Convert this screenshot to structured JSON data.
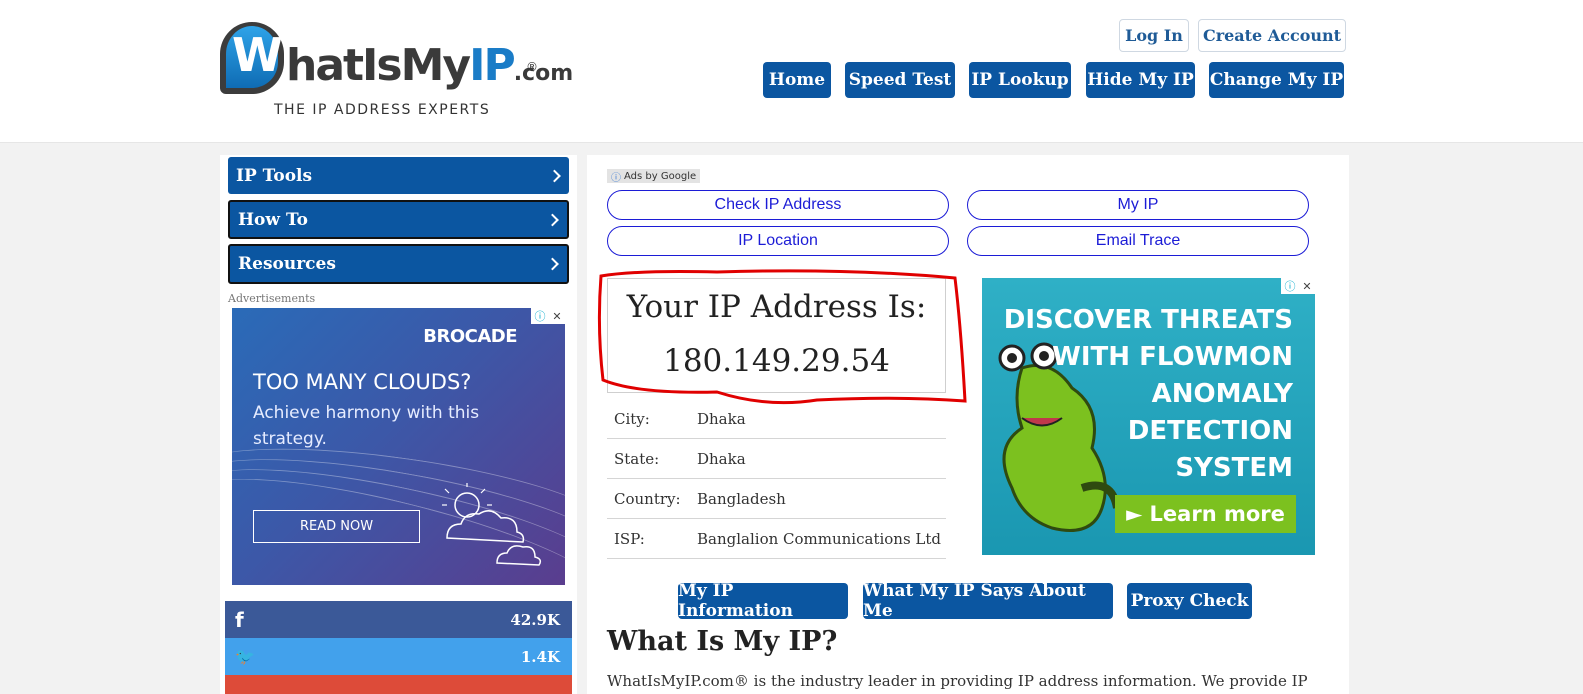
{
  "header": {
    "logo": {
      "w": "W",
      "text_a": "hatIsMy",
      "text_b": "IP",
      "text_com": ".com",
      "reg": "®",
      "tagline": "THE IP ADDRESS EXPERTS"
    },
    "auth": {
      "login": "Log In",
      "create": "Create Account"
    },
    "nav": [
      "Home",
      "Speed Test",
      "IP Lookup",
      "Hide My IP",
      "Change My IP"
    ]
  },
  "sidebar": {
    "items": [
      "IP Tools",
      "How To",
      "Resources"
    ],
    "ads_label": "Advertisements",
    "ad": {
      "brand": "BROCADE",
      "headline": "TOO MANY CLOUDS?",
      "body": "Achieve harmony with this strategy.",
      "cta": "READ NOW",
      "close_info": "ⓘ",
      "close_x": "✕"
    },
    "social": [
      {
        "icon": "f",
        "count": "42.9K",
        "color": "#3b5998"
      },
      {
        "icon": "🐦",
        "count": "1.4K",
        "color": "#42a1ec"
      }
    ]
  },
  "main": {
    "ads_by": {
      "info": "ⓘ",
      "text": "Ads by",
      "brand": "Google"
    },
    "links": [
      "Check IP Address",
      "My IP",
      "IP Location",
      "Email Trace"
    ],
    "ip": {
      "title": "Your IP Address Is:",
      "value": "180.149.29.54"
    },
    "info": [
      {
        "label": "City:",
        "value": "Dhaka"
      },
      {
        "label": "State:",
        "value": "Dhaka"
      },
      {
        "label": "Country:",
        "value": "Bangladesh"
      },
      {
        "label": "ISP:",
        "value": "Banglalion Communications Ltd"
      }
    ],
    "ad": {
      "lines": [
        "DISCOVER THREATS",
        "WITH FLOWMON",
        "ANOMALY",
        "DETECTION",
        "SYSTEM"
      ],
      "cta": "► Learn more",
      "close_info": "ⓘ",
      "close_x": "✕"
    },
    "buttons": [
      "My IP Information",
      "What My IP Says About Me",
      "Proxy Check"
    ],
    "section_title": "What Is My IP?",
    "section_text": "WhatIsMyIP.com® is the industry leader in providing IP address information. We provide IP"
  },
  "colors": {
    "brand_blue": "#0b56a1",
    "link_blue": "#1c1cd6",
    "highlight_red": "#e00000"
  }
}
